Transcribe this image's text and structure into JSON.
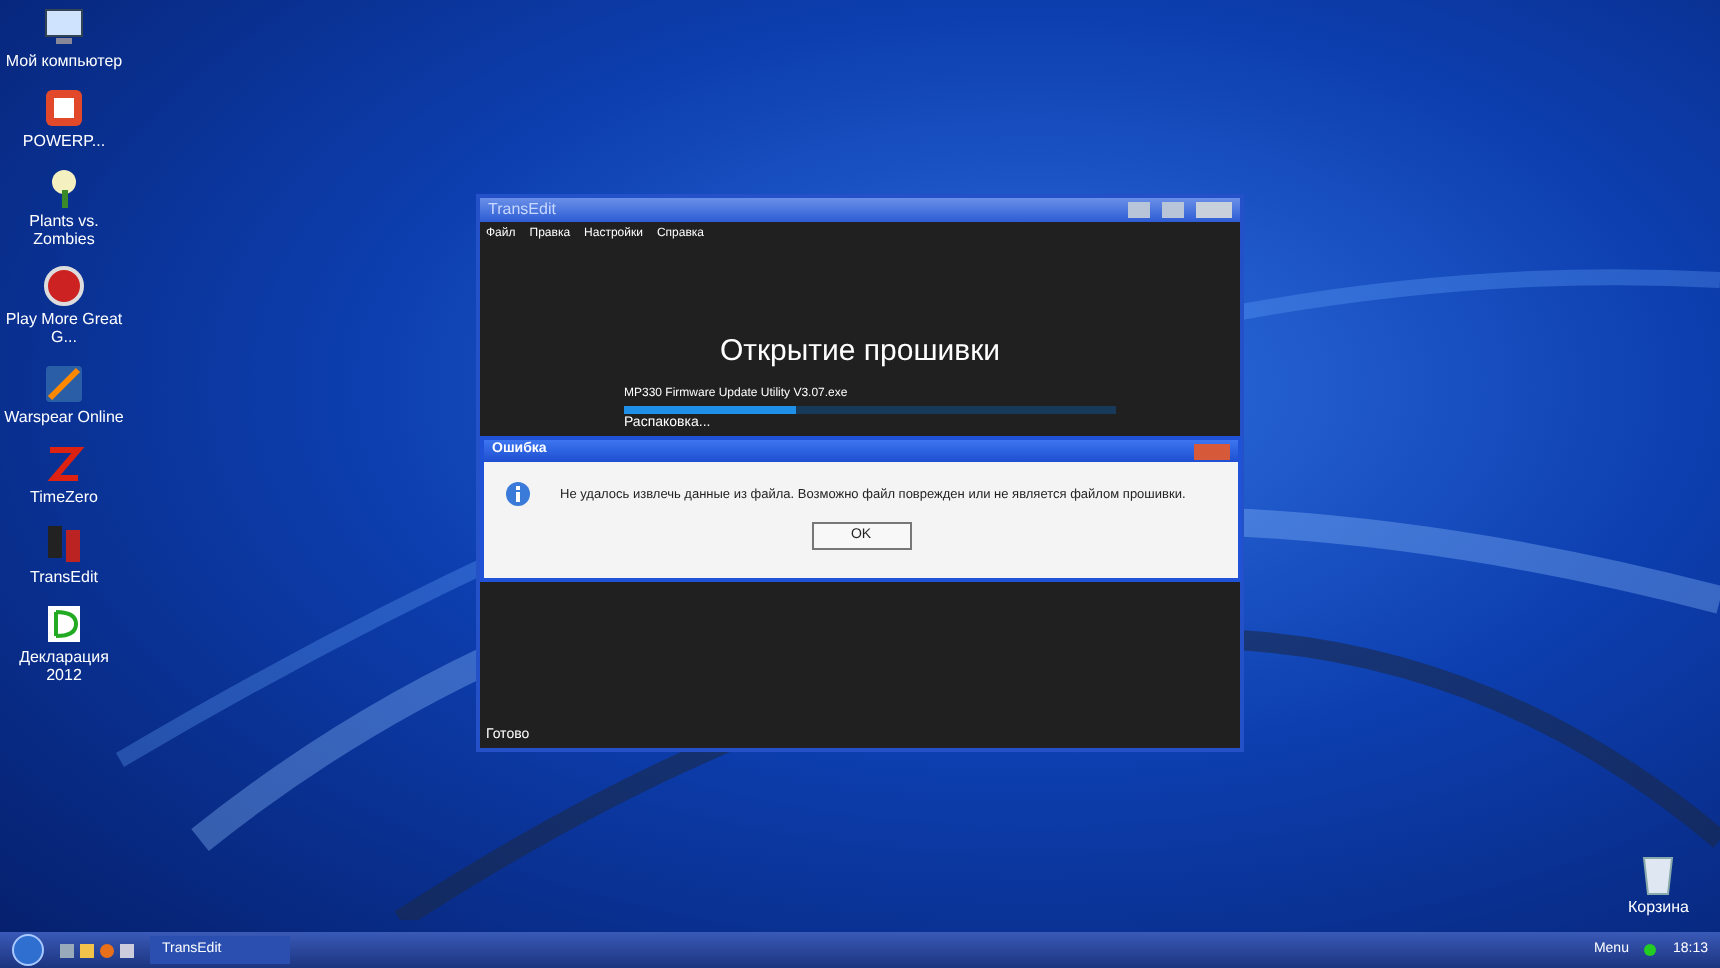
{
  "desktop_icons": [
    {
      "label": "Мой компьютер",
      "kind": "computer"
    },
    {
      "label": "POWERP...",
      "kind": "slides"
    },
    {
      "label": "Plants vs. Zombies",
      "kind": "flower"
    },
    {
      "label": "Play More Great G...",
      "kind": "badge"
    },
    {
      "label": "Warspear Online",
      "kind": "game"
    },
    {
      "label": "TimeZero",
      "kind": "zlogo"
    },
    {
      "label": "TransEdit",
      "kind": "phone"
    },
    {
      "label": "Декларация 2012",
      "kind": "document"
    }
  ],
  "recycle_bin": {
    "label": "Корзина"
  },
  "main_window": {
    "title": "TransEdit",
    "menu": [
      "Файл",
      "Правка",
      "Настройки",
      "Справка"
    ],
    "heading": "Открытие прошивки",
    "file_name": "MP330 Firmware Update Utility V3.07.exe",
    "progress": {
      "level": 0.35
    },
    "step": "Распаковка...",
    "status": "Готово"
  },
  "dialog": {
    "title": "Ошибка",
    "message": "Не удалось извлечь данные из файла. Возможно файл поврежден или не является файлом прошивки.",
    "button": "OK"
  },
  "taskbar": {
    "tasks": [
      {
        "label": "TransEdit",
        "selected": true
      }
    ],
    "tray_menu": "Menu",
    "clock": "18:13"
  }
}
